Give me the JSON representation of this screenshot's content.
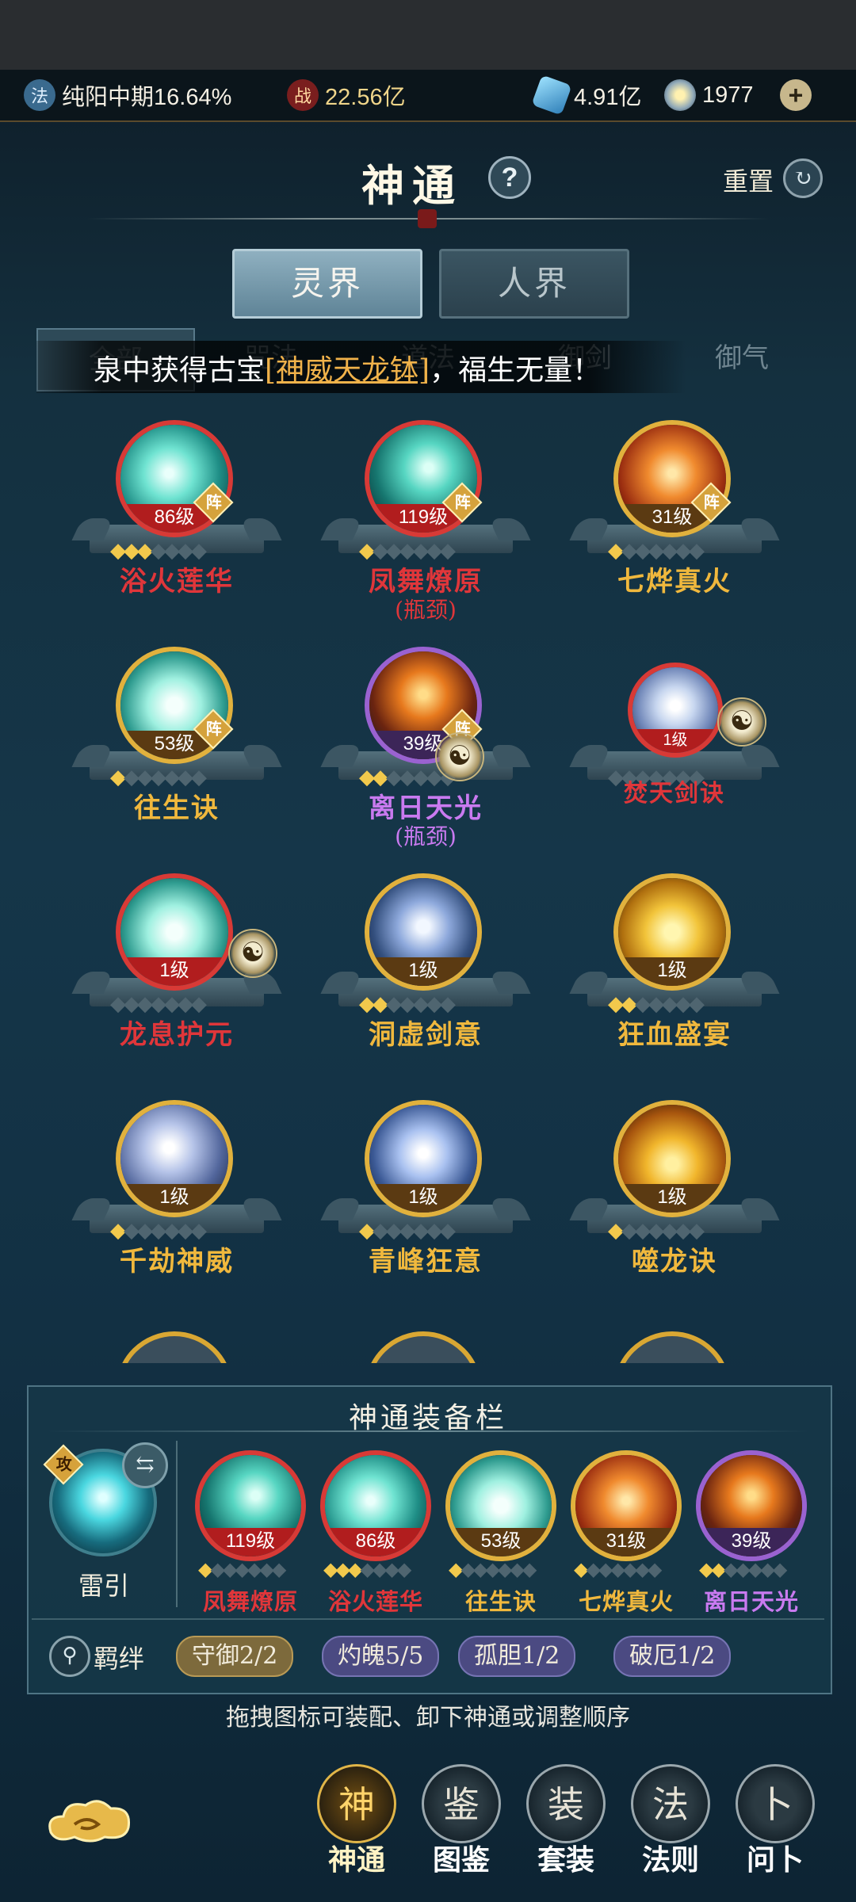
{
  "resources": {
    "realm_text": "纯阳中期16.64%",
    "realm_icon": "realm-icon",
    "power_value": "22.56亿",
    "power_icon_char": "战",
    "currency_value": "4.91亿",
    "gem_value": "1977",
    "add_symbol": "+"
  },
  "header": {
    "title": "神通",
    "help_symbol": "?",
    "reset_label": "重置",
    "reset_symbol": "↻"
  },
  "realm_tabs": [
    "灵界",
    "人界"
  ],
  "filter_tabs": [
    "全部",
    "咒法",
    "道法",
    "御剑",
    "御气"
  ],
  "marquee": {
    "prefix": "泉中获得古宝",
    "highlight": "[神威天龙钵]",
    "suffix": "，福生无量！"
  },
  "skills": [
    {
      "name": "浴火莲华",
      "level": "86级",
      "stars": 3,
      "tier": "red",
      "art": "teal",
      "zhen": "阵",
      "sub": ""
    },
    {
      "name": "凤舞燎原",
      "level": "119级",
      "stars": 1,
      "tier": "red",
      "art": "teal2",
      "zhen": "阵",
      "sub": "(瓶颈)"
    },
    {
      "name": "七烨真火",
      "level": "31级",
      "stars": 1,
      "tier": "gold",
      "art": "fire",
      "zhen": "阵",
      "sub": ""
    },
    {
      "name": "往生诀",
      "level": "53级",
      "stars": 1,
      "tier": "gold",
      "art": "jade",
      "zhen": "阵",
      "sub": ""
    },
    {
      "name": "离日天光",
      "level": "39级",
      "stars": 2,
      "tier": "purple",
      "art": "lava",
      "zhen": "阵",
      "sub": "(瓶颈)"
    },
    {
      "name": "焚天剑诀",
      "level": "1级",
      "stars": 0,
      "tier": "red",
      "art": "ice",
      "zhen": "",
      "sub": ""
    },
    {
      "name": "龙息护元",
      "level": "1级",
      "stars": 0,
      "tier": "red",
      "art": "jade",
      "zhen": "",
      "sub": ""
    },
    {
      "name": "洞虚剑意",
      "level": "1级",
      "stars": 2,
      "tier": "gold",
      "art": "storm",
      "zhen": "",
      "sub": ""
    },
    {
      "name": "狂血盛宴",
      "level": "1级",
      "stars": 2,
      "tier": "gold",
      "art": "gold",
      "zhen": "",
      "sub": ""
    },
    {
      "name": "千劫神威",
      "level": "1级",
      "stars": 1,
      "tier": "gold",
      "art": "blade",
      "zhen": "",
      "sub": ""
    },
    {
      "name": "青峰狂意",
      "level": "1级",
      "stars": 1,
      "tier": "gold",
      "art": "thunder",
      "zhen": "",
      "sub": ""
    },
    {
      "name": "噬龙诀",
      "level": "1级",
      "stars": 1,
      "tier": "gold",
      "art": "dragon",
      "zhen": "",
      "sub": ""
    }
  ],
  "equip": {
    "title": "神通装备栏",
    "passive_tag": "攻",
    "passive_name": "雷引",
    "swap_symbol": "⇆",
    "slots": [
      {
        "name": "凤舞燎原",
        "level": "119级",
        "stars": 1,
        "tier": "red",
        "art": "teal2"
      },
      {
        "name": "浴火莲华",
        "level": "86级",
        "stars": 3,
        "tier": "red",
        "art": "teal"
      },
      {
        "name": "往生诀",
        "level": "53级",
        "stars": 1,
        "tier": "gold",
        "art": "jade"
      },
      {
        "name": "七烨真火",
        "level": "31级",
        "stars": 1,
        "tier": "gold",
        "art": "fire"
      },
      {
        "name": "离日天光",
        "level": "39级",
        "stars": 2,
        "tier": "purple",
        "art": "lava"
      }
    ],
    "bond_label": "羁绊",
    "bonds": [
      {
        "label": "守御2/2",
        "style": "b1"
      },
      {
        "label": "灼魄5/5",
        "style": "b2"
      },
      {
        "label": "孤胆1/2",
        "style": "b2"
      },
      {
        "label": "破厄1/2",
        "style": "b2"
      }
    ],
    "hint": "拖拽图标可装配、卸下神通或调整顺序"
  },
  "nav": [
    {
      "label": "神通",
      "icon": "神",
      "active": true
    },
    {
      "label": "图鉴",
      "icon": "鉴",
      "active": false
    },
    {
      "label": "套装",
      "icon": "装",
      "active": false
    },
    {
      "label": "法则",
      "icon": "法",
      "active": false
    },
    {
      "label": "问卜",
      "icon": "卜",
      "active": false
    }
  ]
}
